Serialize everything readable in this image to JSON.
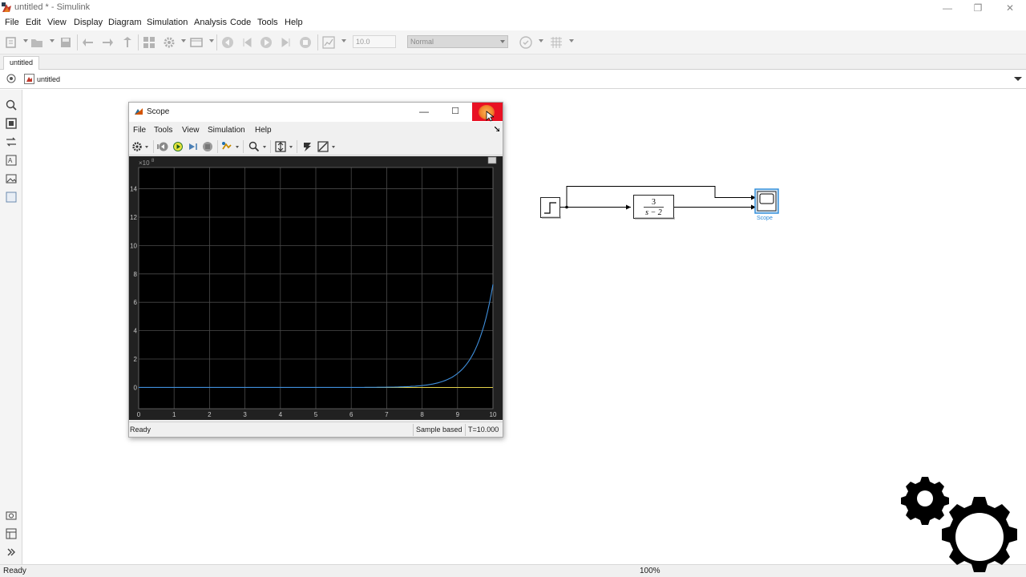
{
  "window": {
    "title": "untitled * - Simulink",
    "controls": {
      "minimize": "—",
      "restore": "❐",
      "close": "✕"
    }
  },
  "menu": [
    "File",
    "Edit",
    "View",
    "Display",
    "Diagram",
    "Simulation",
    "Analysis",
    "Code",
    "Tools",
    "Help"
  ],
  "toolbar": {
    "stop_time": "10.0",
    "sim_mode": "Normal"
  },
  "tabs": [
    {
      "label": "untitled"
    }
  ],
  "address": {
    "path": "untitled"
  },
  "status": {
    "ready": "Ready",
    "zoom": "100%"
  },
  "scope": {
    "title": "Scope",
    "menu": [
      "File",
      "Tools",
      "View",
      "Simulation",
      "Help"
    ],
    "status_ready": "Ready",
    "status_mode": "Sample based",
    "status_time": "T=10.000",
    "y_exponent_base": "×10",
    "y_exponent_power": "8"
  },
  "diagram": {
    "tf_numerator": "3",
    "tf_denominator": "s − 2",
    "scope_label": "Scope"
  },
  "colors": {
    "plot_bg": "#000000",
    "series_1": "#3f8fdc",
    "series_2": "#e4d34a",
    "close_red": "#e81123",
    "selection_blue": "#2b8ad8"
  },
  "chart_data": {
    "type": "line",
    "title": "",
    "xlabel": "",
    "ylabel": "",
    "xlim": [
      0,
      10
    ],
    "ylim": [
      -1.5,
      15.5
    ],
    "x_ticks": [
      "0",
      "1",
      "2",
      "3",
      "4",
      "5",
      "6",
      "7",
      "8",
      "9",
      "10"
    ],
    "y_ticks": [
      {
        "value": 0,
        "label": "0"
      },
      {
        "value": 2,
        "label": "2"
      },
      {
        "value": 4,
        "label": "4"
      },
      {
        "value": 6,
        "label": "6"
      },
      {
        "value": 8,
        "label": "8"
      },
      {
        "value": 10,
        "label": "10"
      },
      {
        "value": 12,
        "label": "12"
      },
      {
        "value": 14,
        "label": "14"
      }
    ],
    "y_scale_factor": 100000000,
    "grid": true,
    "series": [
      {
        "x": [
          0,
          1,
          2,
          3,
          4,
          5,
          6,
          7,
          7.5,
          8,
          8.5,
          9,
          9.25,
          9.5,
          9.75,
          10
        ],
        "values": [
          0,
          0,
          0,
          0,
          0,
          0,
          0.002,
          0.018,
          0.05,
          0.13,
          0.36,
          0.98,
          1.62,
          2.67,
          4.4,
          7.26
        ]
      },
      {
        "x": [
          0,
          10
        ],
        "values": [
          0,
          0
        ]
      }
    ]
  }
}
